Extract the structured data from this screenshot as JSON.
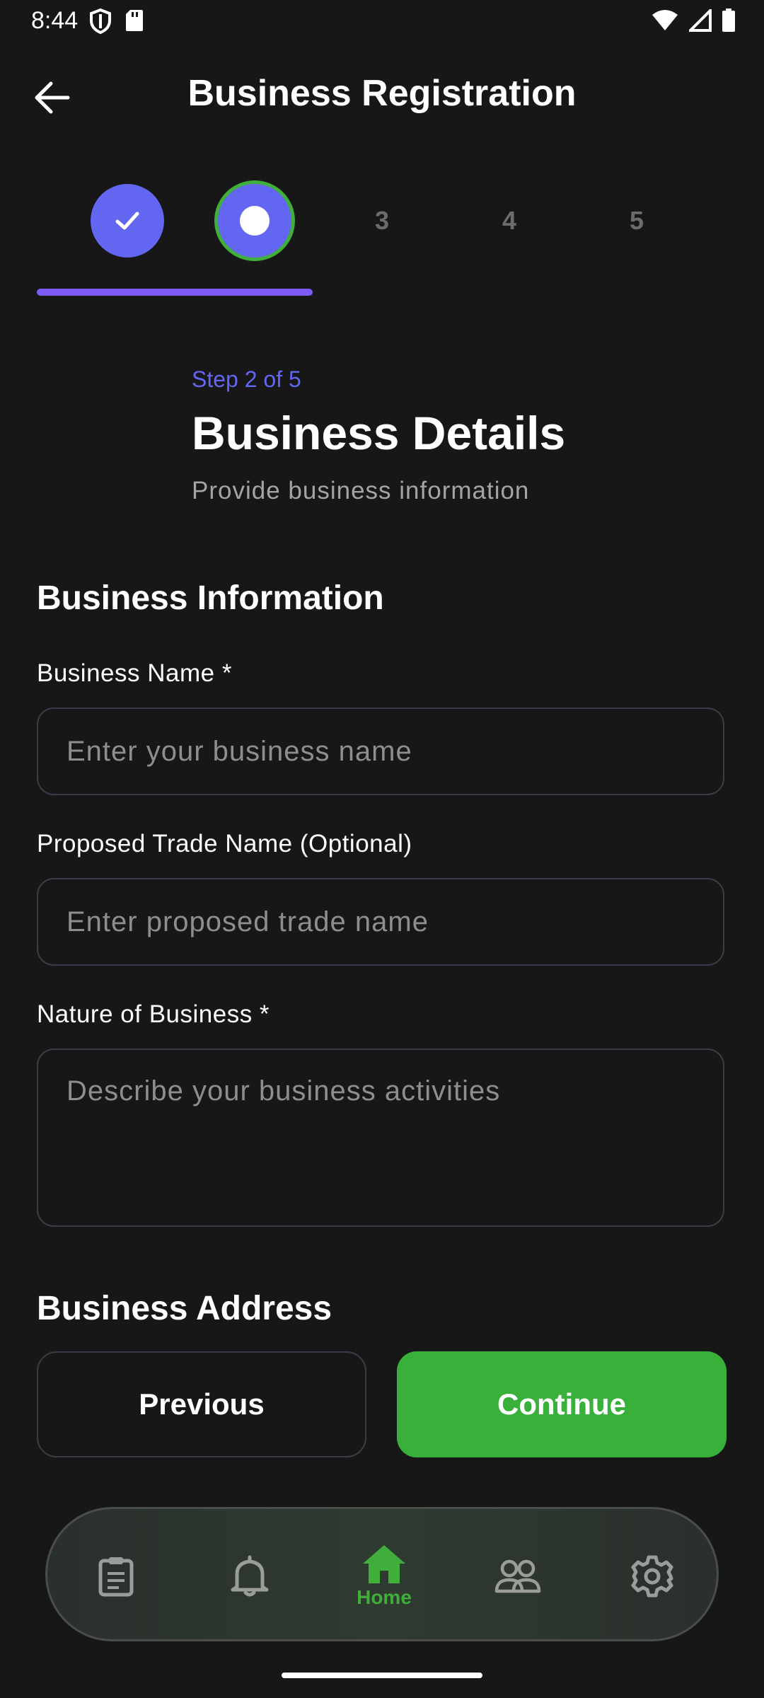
{
  "status_bar": {
    "time": "8:44"
  },
  "app_bar": {
    "title": "Business Registration"
  },
  "stepper": {
    "steps": [
      "1",
      "2",
      "3",
      "4",
      "5"
    ],
    "current_step": 2,
    "total_steps": 5,
    "progress_fraction": 0.4
  },
  "heading": {
    "step_label": "Step 2 of 5",
    "title": "Business Details",
    "subtitle": "Provide business information"
  },
  "form": {
    "section_info_title": "Business Information",
    "business_name": {
      "label": "Business Name *",
      "placeholder": "Enter your business name",
      "value": ""
    },
    "trade_name": {
      "label": "Proposed Trade Name (Optional)",
      "placeholder": "Enter proposed trade name",
      "value": ""
    },
    "nature": {
      "label": "Nature of Business *",
      "placeholder": "Describe your business activities",
      "value": ""
    },
    "section_address_title": "Business Address"
  },
  "buttons": {
    "previous": "Previous",
    "continue": "Continue"
  },
  "bottom_nav": {
    "items": [
      {
        "icon": "clipboard-icon",
        "label": ""
      },
      {
        "icon": "bell-icon",
        "label": ""
      },
      {
        "icon": "home-icon",
        "label": "Home",
        "active": true
      },
      {
        "icon": "people-icon",
        "label": ""
      },
      {
        "icon": "gear-icon",
        "label": ""
      }
    ]
  },
  "colors": {
    "background": "#171718",
    "accent_indigo": "#6366f1",
    "accent_green": "#38b03a",
    "border": "#3a3d48"
  }
}
